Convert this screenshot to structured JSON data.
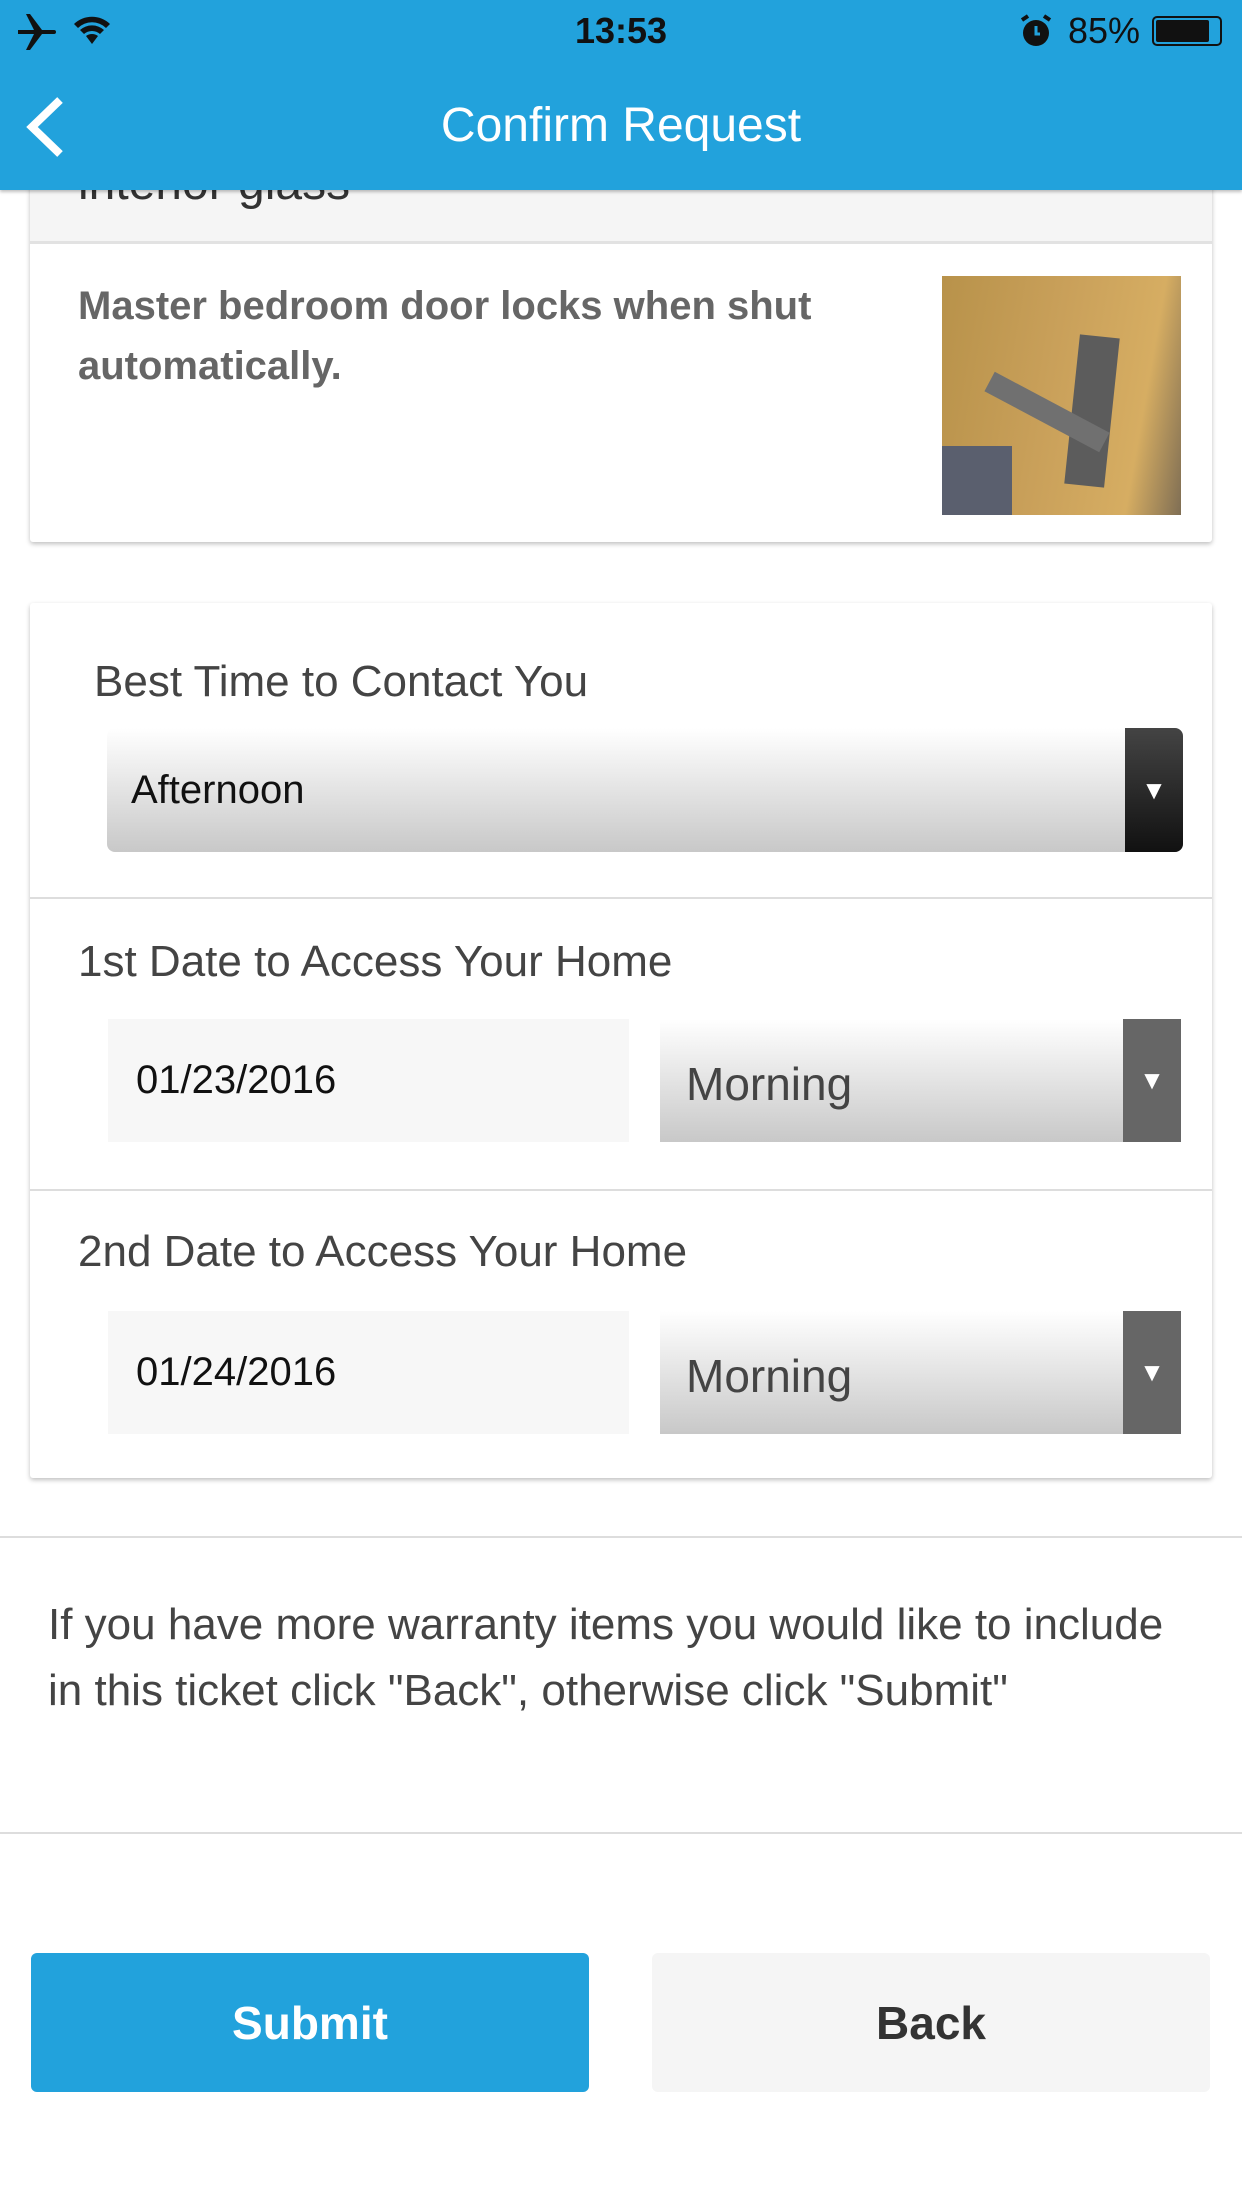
{
  "status_bar": {
    "time": "13:53",
    "battery": "85%",
    "icons": [
      "airplane-icon",
      "wifi-icon",
      "alarm-icon",
      "battery-icon"
    ]
  },
  "header": {
    "title": "Confirm Request",
    "back_icon": "chevron-left-icon"
  },
  "item": {
    "title": "interior glass",
    "description": "Master bedroom door locks when shut automatically.",
    "photo": "door-handle-photo"
  },
  "contact": {
    "label": "Best Time to Contact You",
    "value": "Afternoon"
  },
  "date1": {
    "label": "1st Date to Access Your Home",
    "date": "01/23/2016",
    "time": "Morning"
  },
  "date2": {
    "label": "2nd Date to Access Your Home",
    "date": "01/24/2016",
    "time": "Morning"
  },
  "instructions": "If you have more warranty items you would like to include in this ticket click \"Back\", otherwise click \"Submit\"",
  "buttons": {
    "submit": "Submit",
    "back": "Back"
  },
  "colors": {
    "accent": "#22a2dc"
  }
}
